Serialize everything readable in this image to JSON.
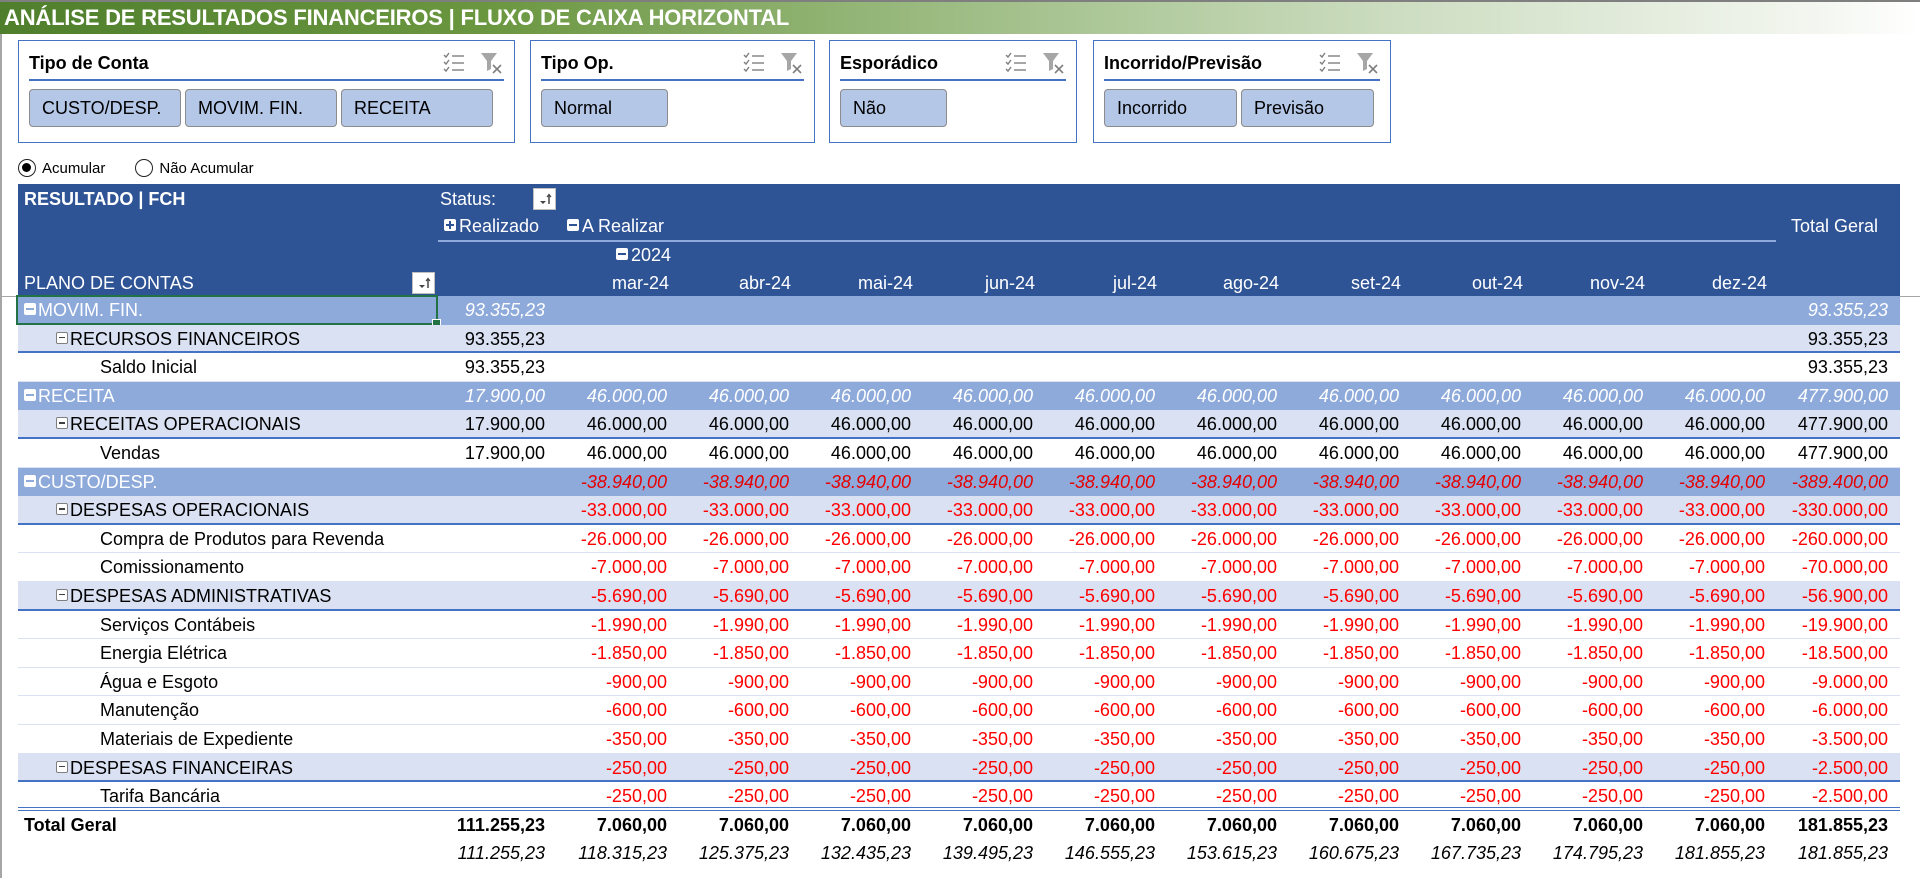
{
  "title": "ANÁLISE DE RESULTADOS FINANCEIROS | FLUXO DE CAIXA HORIZONTAL",
  "colors": {
    "title_bar": "#548235",
    "header_bg": "#2f5496",
    "group_bg": "#8eaadb",
    "subgroup_bg": "#d9e1f2",
    "slicer_item": "#b4c7e7",
    "negative": "#ff0000",
    "selection": "#217346"
  },
  "slicers": [
    {
      "title": "Tipo de Conta",
      "items": [
        "CUSTO/DESP.",
        "MOVIM. FIN.",
        "RECEITA"
      ]
    },
    {
      "title": "Tipo Op.",
      "items": [
        "Normal"
      ]
    },
    {
      "title": "Esporádico",
      "items": [
        "Não"
      ]
    },
    {
      "title": "Incorrido/Previsão",
      "items": [
        "Incorrido",
        "Previsão"
      ]
    }
  ],
  "slicer_icons": {
    "multi_select": "multi-select-icon",
    "clear_filter": "clear-filter-icon"
  },
  "radio": {
    "options": [
      {
        "label": "Acumular",
        "checked": true
      },
      {
        "label": "Não Acumular",
        "checked": false
      }
    ]
  },
  "pivot": {
    "title": "RESULTADO | FCH",
    "status_label": "Status:",
    "status_groups": [
      {
        "label": "Realizado",
        "expanded": false
      },
      {
        "label": "A Realizar",
        "expanded": true
      }
    ],
    "year_label": "2024",
    "row_header": "PLANO DE CONTAS",
    "total_header": "Total Geral",
    "months": [
      "mar-24",
      "abr-24",
      "mai-24",
      "jun-24",
      "jul-24",
      "ago-24",
      "set-24",
      "out-24",
      "nov-24",
      "dez-24"
    ],
    "rows": [
      {
        "level": 0,
        "label": "MOVIM. FIN.",
        "realizado": "93.355,23",
        "months": [
          "",
          "",
          "",
          "",
          "",
          "",
          "",
          "",
          "",
          ""
        ],
        "total": "93.355,23",
        "negative": false,
        "selected": true
      },
      {
        "level": 1,
        "label": "RECURSOS FINANCEIROS",
        "realizado": "93.355,23",
        "months": [
          "",
          "",
          "",
          "",
          "",
          "",
          "",
          "",
          "",
          ""
        ],
        "total": "93.355,23",
        "negative": false
      },
      {
        "level": 2,
        "label": "Saldo Inicial",
        "realizado": "93.355,23",
        "months": [
          "",
          "",
          "",
          "",
          "",
          "",
          "",
          "",
          "",
          ""
        ],
        "total": "93.355,23",
        "negative": false
      },
      {
        "level": 0,
        "label": "RECEITA",
        "realizado": "17.900,00",
        "months": [
          "46.000,00",
          "46.000,00",
          "46.000,00",
          "46.000,00",
          "46.000,00",
          "46.000,00",
          "46.000,00",
          "46.000,00",
          "46.000,00",
          "46.000,00"
        ],
        "total": "477.900,00",
        "negative": false
      },
      {
        "level": 1,
        "label": "RECEITAS OPERACIONAIS",
        "realizado": "17.900,00",
        "months": [
          "46.000,00",
          "46.000,00",
          "46.000,00",
          "46.000,00",
          "46.000,00",
          "46.000,00",
          "46.000,00",
          "46.000,00",
          "46.000,00",
          "46.000,00"
        ],
        "total": "477.900,00",
        "negative": false
      },
      {
        "level": 2,
        "label": "Vendas",
        "realizado": "17.900,00",
        "months": [
          "46.000,00",
          "46.000,00",
          "46.000,00",
          "46.000,00",
          "46.000,00",
          "46.000,00",
          "46.000,00",
          "46.000,00",
          "46.000,00",
          "46.000,00"
        ],
        "total": "477.900,00",
        "negative": false
      },
      {
        "level": 0,
        "label": "CUSTO/DESP.",
        "realizado": "",
        "months": [
          "-38.940,00",
          "-38.940,00",
          "-38.940,00",
          "-38.940,00",
          "-38.940,00",
          "-38.940,00",
          "-38.940,00",
          "-38.940,00",
          "-38.940,00",
          "-38.940,00"
        ],
        "total": "-389.400,00",
        "negative": true
      },
      {
        "level": 1,
        "label": "DESPESAS OPERACIONAIS",
        "realizado": "",
        "months": [
          "-33.000,00",
          "-33.000,00",
          "-33.000,00",
          "-33.000,00",
          "-33.000,00",
          "-33.000,00",
          "-33.000,00",
          "-33.000,00",
          "-33.000,00",
          "-33.000,00"
        ],
        "total": "-330.000,00",
        "negative": true
      },
      {
        "level": 2,
        "label": "Compra de Produtos para Revenda",
        "realizado": "",
        "months": [
          "-26.000,00",
          "-26.000,00",
          "-26.000,00",
          "-26.000,00",
          "-26.000,00",
          "-26.000,00",
          "-26.000,00",
          "-26.000,00",
          "-26.000,00",
          "-26.000,00"
        ],
        "total": "-260.000,00",
        "negative": true
      },
      {
        "level": 2,
        "label": "Comissionamento",
        "realizado": "",
        "months": [
          "-7.000,00",
          "-7.000,00",
          "-7.000,00",
          "-7.000,00",
          "-7.000,00",
          "-7.000,00",
          "-7.000,00",
          "-7.000,00",
          "-7.000,00",
          "-7.000,00"
        ],
        "total": "-70.000,00",
        "negative": true
      },
      {
        "level": 1,
        "label": "DESPESAS ADMINISTRATIVAS",
        "realizado": "",
        "months": [
          "-5.690,00",
          "-5.690,00",
          "-5.690,00",
          "-5.690,00",
          "-5.690,00",
          "-5.690,00",
          "-5.690,00",
          "-5.690,00",
          "-5.690,00",
          "-5.690,00"
        ],
        "total": "-56.900,00",
        "negative": true
      },
      {
        "level": 2,
        "label": "Serviços Contábeis",
        "realizado": "",
        "months": [
          "-1.990,00",
          "-1.990,00",
          "-1.990,00",
          "-1.990,00",
          "-1.990,00",
          "-1.990,00",
          "-1.990,00",
          "-1.990,00",
          "-1.990,00",
          "-1.990,00"
        ],
        "total": "-19.900,00",
        "negative": true
      },
      {
        "level": 2,
        "label": "Energia Elétrica",
        "realizado": "",
        "months": [
          "-1.850,00",
          "-1.850,00",
          "-1.850,00",
          "-1.850,00",
          "-1.850,00",
          "-1.850,00",
          "-1.850,00",
          "-1.850,00",
          "-1.850,00",
          "-1.850,00"
        ],
        "total": "-18.500,00",
        "negative": true
      },
      {
        "level": 2,
        "label": "Água e Esgoto",
        "realizado": "",
        "months": [
          "-900,00",
          "-900,00",
          "-900,00",
          "-900,00",
          "-900,00",
          "-900,00",
          "-900,00",
          "-900,00",
          "-900,00",
          "-900,00"
        ],
        "total": "-9.000,00",
        "negative": true
      },
      {
        "level": 2,
        "label": "Manutenção",
        "realizado": "",
        "months": [
          "-600,00",
          "-600,00",
          "-600,00",
          "-600,00",
          "-600,00",
          "-600,00",
          "-600,00",
          "-600,00",
          "-600,00",
          "-600,00"
        ],
        "total": "-6.000,00",
        "negative": true
      },
      {
        "level": 2,
        "label": "Materiais de Expediente",
        "realizado": "",
        "months": [
          "-350,00",
          "-350,00",
          "-350,00",
          "-350,00",
          "-350,00",
          "-350,00",
          "-350,00",
          "-350,00",
          "-350,00",
          "-350,00"
        ],
        "total": "-3.500,00",
        "negative": true
      },
      {
        "level": 1,
        "label": "DESPESAS FINANCEIRAS",
        "realizado": "",
        "months": [
          "-250,00",
          "-250,00",
          "-250,00",
          "-250,00",
          "-250,00",
          "-250,00",
          "-250,00",
          "-250,00",
          "-250,00",
          "-250,00"
        ],
        "total": "-2.500,00",
        "negative": true
      },
      {
        "level": 2,
        "label": "Tarifa Bancária",
        "realizado": "",
        "months": [
          "-250,00",
          "-250,00",
          "-250,00",
          "-250,00",
          "-250,00",
          "-250,00",
          "-250,00",
          "-250,00",
          "-250,00",
          "-250,00"
        ],
        "total": "-2.500,00",
        "negative": true,
        "last": true
      }
    ],
    "grand_total": {
      "label": "Total Geral",
      "realizado": "111.255,23",
      "months": [
        "7.060,00",
        "7.060,00",
        "7.060,00",
        "7.060,00",
        "7.060,00",
        "7.060,00",
        "7.060,00",
        "7.060,00",
        "7.060,00",
        "7.060,00"
      ],
      "total": "181.855,23"
    },
    "cumulative": {
      "realizado": "111.255,23",
      "months": [
        "118.315,23",
        "125.375,23",
        "132.435,23",
        "139.495,23",
        "146.555,23",
        "153.615,23",
        "160.675,23",
        "167.735,23",
        "174.795,23",
        "181.855,23"
      ],
      "total": "181.855,23"
    }
  }
}
